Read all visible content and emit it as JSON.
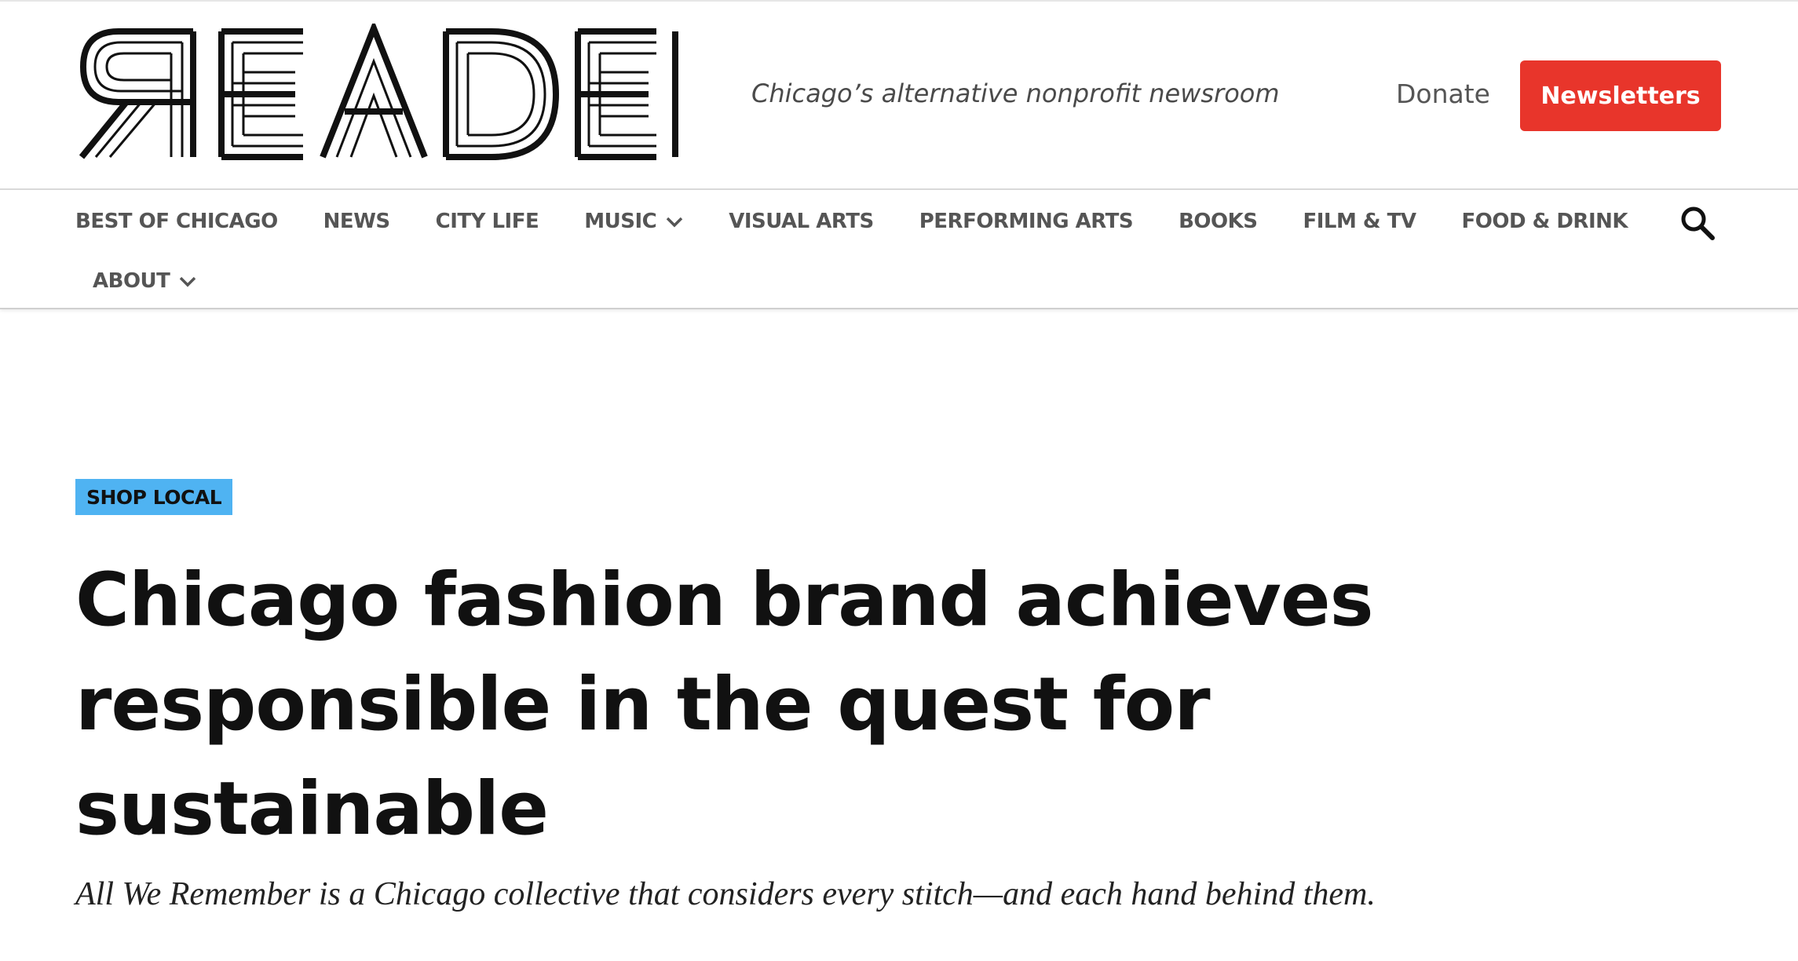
{
  "header": {
    "logo_text": "READER",
    "tagline": "Chicago’s alternative nonprofit newsroom",
    "donate_label": "Donate",
    "newsletters_label": "Newsletters"
  },
  "nav": {
    "items": [
      {
        "label": "BEST OF CHICAGO"
      },
      {
        "label": "NEWS"
      },
      {
        "label": "CITY LIFE"
      },
      {
        "label": "MUSIC",
        "has_dropdown": true
      },
      {
        "label": "VISUAL ARTS"
      },
      {
        "label": "PERFORMING ARTS"
      },
      {
        "label": "BOOKS"
      },
      {
        "label": "FILM & TV"
      },
      {
        "label": "FOOD & DRINK"
      },
      {
        "label": "ABOUT",
        "has_dropdown": true
      }
    ],
    "search_icon": "search-icon"
  },
  "article": {
    "kicker": "SHOP LOCAL",
    "headline": "Chicago fashion brand achieves responsible in the quest for sustainable",
    "dek": "All We Remember is a Chicago collective that considers every stitch—and each hand behind them."
  },
  "colors": {
    "accent_red": "#e8352b",
    "kicker_blue": "#4fb3f2",
    "nav_text": "#555555",
    "headline_text": "#111111"
  }
}
